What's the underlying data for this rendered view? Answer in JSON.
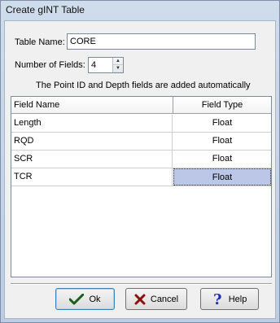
{
  "window": {
    "title": "Create gINT Table"
  },
  "form": {
    "table_name_label": "Table Name:",
    "table_name_value": "CORE",
    "num_fields_label": "Number of Fields:",
    "num_fields_value": "4",
    "info_text": "The Point ID and Depth fields are added automatically"
  },
  "grid": {
    "columns": [
      "Field Name",
      "Field Type"
    ],
    "rows": [
      {
        "name": "Length",
        "type": "Float"
      },
      {
        "name": "RQD",
        "type": "Float"
      },
      {
        "name": "SCR",
        "type": "Float"
      },
      {
        "name": "TCR",
        "type": "Float"
      }
    ]
  },
  "buttons": {
    "ok": "Ok",
    "cancel": "Cancel",
    "help": "Help"
  },
  "icons": {
    "ok": "checkmark-icon",
    "cancel": "x-icon",
    "help": "question-mark-icon",
    "spin_up": "spin-up-icon",
    "spin_down": "spin-down-icon"
  },
  "colors": {
    "selected_cell": "#bcc7e8",
    "ok_icon": "#1a5e1a",
    "cancel_icon": "#8a1010",
    "help_icon": "#1d2fa8"
  }
}
